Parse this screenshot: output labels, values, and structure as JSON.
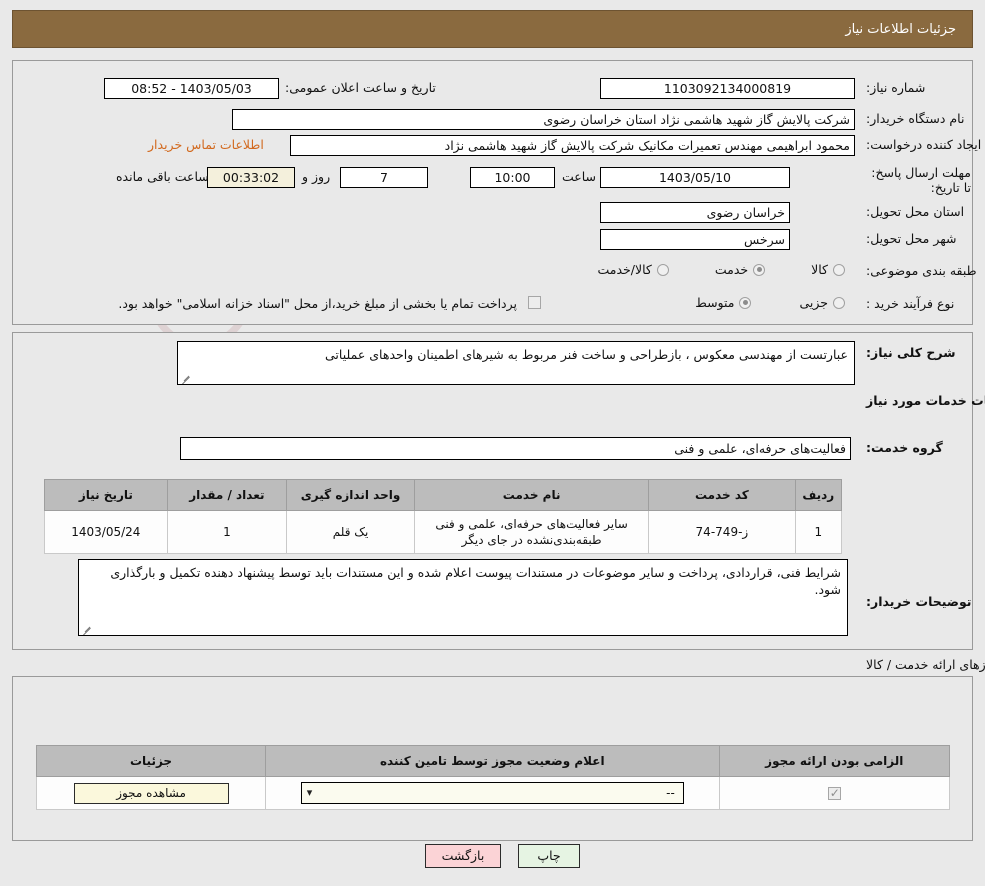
{
  "header": {
    "title": "جزئیات اطلاعات نیاز"
  },
  "top_panel": {
    "need_number_label": "شماره نیاز:",
    "need_number_value": "1103092134000819",
    "announce_datetime_label": "تاریخ و ساعت اعلان عمومی:",
    "announce_datetime_value": "1403/05/03 - 08:52",
    "buyer_org_label": "نام دستگاه خریدار:",
    "buyer_org_value": "شرکت پالایش گاز شهید هاشمی نژاد   استان خراسان رضوی",
    "requester_label": "ایجاد کننده درخواست:",
    "requester_value": "محمود ابراهیمی مهندس تعمیرات مکانیک شرکت پالایش گاز شهید هاشمی نژاد",
    "contact_link": "اطلاعات تماس خریدار",
    "deadline_label": "مهلت ارسال پاسخ: تا تاریخ:",
    "deadline_date": "1403/05/10",
    "hour_label": "ساعت",
    "deadline_time": "10:00",
    "days_value": "7",
    "days_label": "روز و",
    "countdown_value": "00:33:02",
    "countdown_label": "ساعت باقی مانده",
    "province_label": "استان محل تحویل:",
    "province_value": "خراسان رضوی",
    "city_label": "شهر محل تحویل:",
    "city_value": "سرخس",
    "category_label": "طبقه بندی موضوعی:",
    "category_options": [
      {
        "label": "کالا",
        "checked": false
      },
      {
        "label": "خدمت",
        "checked": true
      },
      {
        "label": "کالا/خدمت",
        "checked": false
      }
    ],
    "process_label": "نوع فرآیند خرید :",
    "process_options": [
      {
        "label": "جزیی",
        "checked": false
      },
      {
        "label": "متوسط",
        "checked": true
      }
    ],
    "payment_checkbox_checked": false,
    "payment_note": "پرداخت تمام یا بخشی از مبلغ خرید،از محل \"اسناد خزانه اسلامی\" خواهد بود."
  },
  "mid_panel": {
    "need_desc_label": "شرح کلی نیاز:",
    "need_desc_value": "عبارتست از مهندسی معکوس ، بازطراحی و ساخت فنر مربوط به شیرهای اطمینان واحدهای عملیاتی",
    "services_section_title": "اطلاعات خدمات مورد نیاز",
    "service_group_label": "گروه خدمت:",
    "service_group_value": "فعالیت‌های حرفه‌ای، علمی و فنی",
    "table_headers": [
      "ردیف",
      "کد خدمت",
      "نام خدمت",
      "واحد اندازه گیری",
      "تعداد / مقدار",
      "تاریخ نیاز"
    ],
    "table_rows": [
      {
        "row_no": "1",
        "service_code": "ز-749-74",
        "service_name": "سایر فعالیت‌های حرفه‌ای، علمی و فنی طبقه‌بندی‌نشده در جای دیگر",
        "unit": "یک قلم",
        "quantity": "1",
        "need_date": "1403/05/24"
      }
    ],
    "buyer_notes_label": "توضیحات خریدار:",
    "buyer_notes_value": "شرایط فنی، قراردادی، پرداخت و سایر موضوعات در مستندات پیوست اعلام شده و این مستندات باید توسط پیشنهاد دهنده تکمیل و  بارگذاری شود."
  },
  "permits": {
    "section_title": "اطلاعات مجوزهای ارائه خدمت / کالا",
    "table_headers": [
      "الزامی بودن ارائه مجوز",
      "اعلام وضعیت مجوز توسط تامین کننده",
      "جزئیات"
    ],
    "rows": [
      {
        "required_checked": true,
        "status_value": "--",
        "details_button": "مشاهده مجوز"
      }
    ]
  },
  "footer": {
    "back_button": "بازگشت",
    "print_button": "چاپ"
  },
  "watermark": {
    "text": "AriaTender.net"
  }
}
